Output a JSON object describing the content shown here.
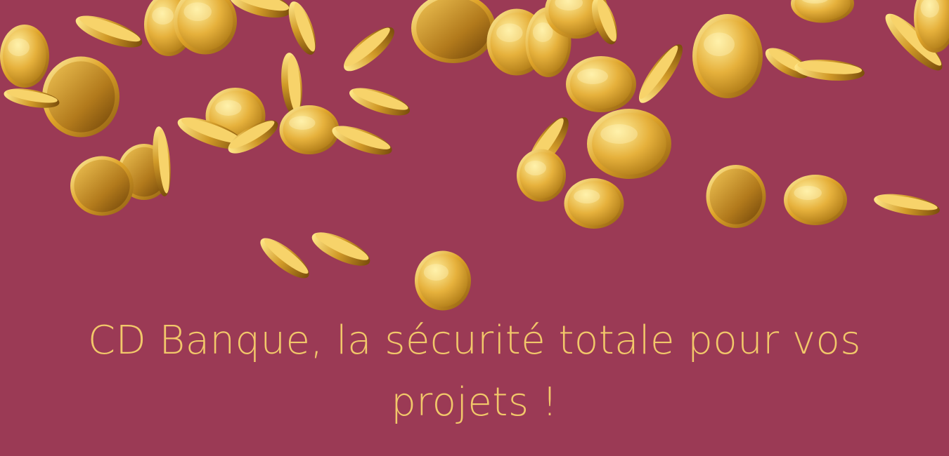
{
  "banner": {
    "tagline": "CD Banque, la sécurité totale pour vos projets !",
    "background_color": "#9b3a55",
    "text_color": "#f2c86a",
    "image": "falling-gold-coins-icon"
  }
}
